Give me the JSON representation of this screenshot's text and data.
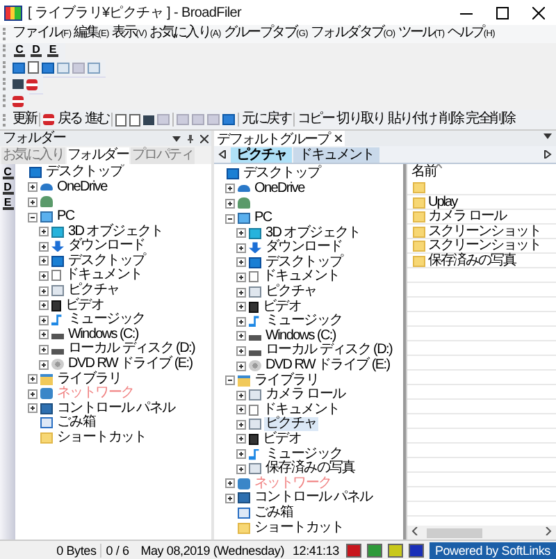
{
  "window": {
    "title": "[ ライブラリ¥ピクチャ ] - BroadFiler"
  },
  "menu": [
    {
      "label": "ファイル",
      "key": "(F)"
    },
    {
      "label": "編集",
      "key": "(E)"
    },
    {
      "label": "表示",
      "key": "(V)"
    },
    {
      "label": "お気に入り",
      "key": "(A)"
    },
    {
      "label": "グループタブ",
      "key": "(G)"
    },
    {
      "label": "フォルダタブ",
      "key": "(O)"
    },
    {
      "label": "ツール",
      "key": "(T)"
    },
    {
      "label": "ヘルプ",
      "key": "(H)"
    }
  ],
  "drive_toolbar": [
    "C",
    "D",
    "E"
  ],
  "main_toolbar": {
    "groups": [
      [
        "更新"
      ],
      [
        "戻る",
        "進む"
      ],
      [
        "元に戻す"
      ],
      [
        "コピー",
        "切り取り",
        "貼り付け",
        "削除",
        "完全削除"
      ]
    ]
  },
  "folder_panel": {
    "title": "フォルダー",
    "tabs": [
      {
        "label": "お気に入り",
        "selected": false
      },
      {
        "label": "フォルダー",
        "selected": true
      },
      {
        "label": "プロパティ",
        "selected": false
      }
    ],
    "drives": [
      "C",
      "D",
      "E"
    ],
    "tree": [
      {
        "label": "デスクトップ",
        "kind": "desktop",
        "children": [
          {
            "label": "OneDrive",
            "kind": "cloud",
            "expanded": false
          },
          {
            "kind": "user",
            "expanded": false
          },
          {
            "label": "PC",
            "kind": "pc",
            "expanded": true,
            "children": [
              {
                "label": "3D オブジェクト",
                "kind": "cube",
                "expanded": false
              },
              {
                "label": "ダウンロード",
                "kind": "download",
                "expanded": false
              },
              {
                "label": "デスクトップ",
                "kind": "desktop",
                "expanded": false
              },
              {
                "label": "ドキュメント",
                "kind": "doc",
                "expanded": false
              },
              {
                "label": "ピクチャ",
                "kind": "picture",
                "expanded": false
              },
              {
                "label": "ビデオ",
                "kind": "video",
                "expanded": false
              },
              {
                "label": "ミュージック",
                "kind": "music",
                "expanded": false
              },
              {
                "label": "Windows (C:)",
                "kind": "drive",
                "expanded": false
              },
              {
                "label": "ローカル ディスク (D:)",
                "kind": "drive",
                "expanded": false
              },
              {
                "label": "DVD RW ドライブ (E:)",
                "kind": "dvd",
                "expanded": false
              }
            ]
          },
          {
            "label": "ライブラリ",
            "kind": "library",
            "expanded": false
          },
          {
            "label": "ネットワーク",
            "kind": "network",
            "expanded": false,
            "highlighted": true
          },
          {
            "label": "コントロール パネル",
            "kind": "control",
            "expanded": false
          },
          {
            "label": "ごみ箱",
            "kind": "trash"
          },
          {
            "label": "ショートカット",
            "kind": "folder"
          }
        ]
      }
    ]
  },
  "group_panel": {
    "group_tab": "デフォルトグループ",
    "folder_tabs": [
      {
        "label": "ピクチャ",
        "selected": true
      },
      {
        "label": "ドキュメント",
        "selected": false
      }
    ],
    "tree": [
      {
        "label": "デスクトップ",
        "kind": "desktop",
        "children": [
          {
            "label": "OneDrive",
            "kind": "cloud",
            "expanded": false
          },
          {
            "kind": "user",
            "expanded": false
          },
          {
            "label": "PC",
            "kind": "pc",
            "expanded": true,
            "children": [
              {
                "label": "3D オブジェクト",
                "kind": "cube",
                "expanded": false
              },
              {
                "label": "ダウンロード",
                "kind": "download",
                "expanded": false
              },
              {
                "label": "デスクトップ",
                "kind": "desktop",
                "expanded": false
              },
              {
                "label": "ドキュメント",
                "kind": "doc",
                "expanded": false
              },
              {
                "label": "ピクチャ",
                "kind": "picture",
                "expanded": false
              },
              {
                "label": "ビデオ",
                "kind": "video",
                "expanded": false
              },
              {
                "label": "ミュージック",
                "kind": "music",
                "expanded": false
              },
              {
                "label": "Windows (C:)",
                "kind": "drive",
                "expanded": false
              },
              {
                "label": "ローカル ディスク (D:)",
                "kind": "drive",
                "expanded": false
              },
              {
                "label": "DVD RW ドライブ (E:)",
                "kind": "dvd",
                "expanded": false
              }
            ]
          },
          {
            "label": "ライブラリ",
            "kind": "library",
            "expanded": true,
            "children": [
              {
                "label": "カメラ ロール",
                "kind": "picture",
                "expanded": false
              },
              {
                "label": "ドキュメント",
                "kind": "doc",
                "expanded": false
              },
              {
                "label": "ピクチャ",
                "kind": "picture",
                "expanded": false,
                "selected": true
              },
              {
                "label": "ビデオ",
                "kind": "video",
                "expanded": false
              },
              {
                "label": "ミュージック",
                "kind": "music",
                "expanded": false
              },
              {
                "label": "保存済みの写真",
                "kind": "picture",
                "expanded": false
              }
            ]
          },
          {
            "label": "ネットワーク",
            "kind": "network",
            "expanded": false,
            "highlighted": true
          },
          {
            "label": "コントロール パネル",
            "kind": "control",
            "expanded": false
          },
          {
            "label": "ごみ箱",
            "kind": "trash"
          },
          {
            "label": "ショートカット",
            "kind": "folder"
          }
        ]
      }
    ],
    "file_list": {
      "columns": [
        "名前"
      ],
      "rows": [
        {
          "kind": "folder"
        },
        {
          "kind": "folder",
          "name": "Uplay"
        },
        {
          "kind": "folder",
          "name": "カメラ ロール"
        },
        {
          "kind": "folder",
          "name": "スクリーンショット"
        },
        {
          "kind": "folder",
          "name": "スクリーンショット"
        },
        {
          "kind": "folder",
          "name": "保存済みの写真"
        }
      ]
    }
  },
  "status_bar": {
    "size": "0 Bytes",
    "count": "0 / 6",
    "date": "May 08,2019 (Wednesday)",
    "time": "12:41:13",
    "swatches": [
      {
        "color": "#c8161d"
      },
      {
        "color": "#2e9a3a"
      },
      {
        "color": "#c8c81a"
      },
      {
        "color": "#1a2fb8"
      }
    ],
    "powered": "Powered by SoftLinks"
  }
}
